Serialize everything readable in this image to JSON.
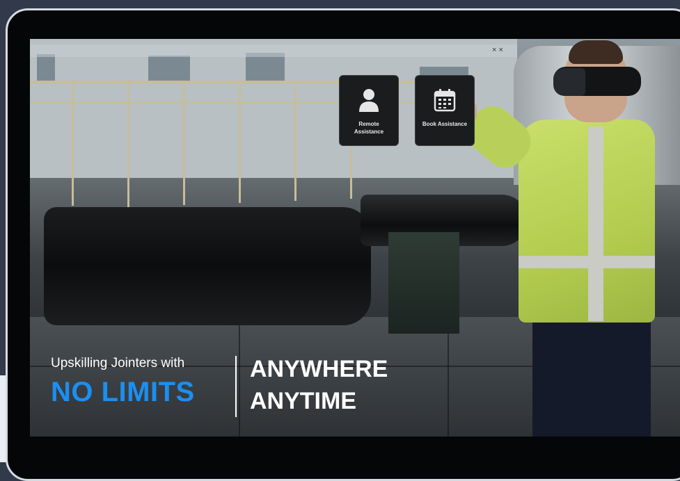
{
  "colors": {
    "frame_bg": "#313a4b",
    "bezel": "#050608",
    "accent_blue": "#1b8ff1",
    "caption_text": "#ffffff",
    "vest": "#c9df6a"
  },
  "holo_panel": {
    "close_glyph": "× ×",
    "tiles": [
      {
        "label": "Remote Assistance",
        "icon": "person-icon"
      },
      {
        "label": "Book Assistance",
        "icon": "calendar-icon"
      }
    ]
  },
  "caption": {
    "tagline": "Upskilling Jointers with",
    "headline": "NO LIMITS",
    "right_line1": "ANYWHERE",
    "right_line2": "ANYTIME"
  }
}
